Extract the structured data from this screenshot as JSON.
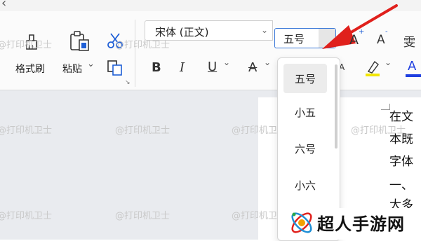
{
  "ribbon": {
    "format_painter_label": "格式刷",
    "paste_label": "粘贴",
    "paste_arrow": "⌄",
    "font_name": "宋体 (正文)",
    "font_size": "五号",
    "partial_right_label": "雯",
    "launcher": "↘"
  },
  "format": {
    "bold": "B",
    "italic": "I",
    "underline": "U",
    "strike": "A",
    "grow": "A",
    "shrink": "A",
    "chevron": "⌄"
  },
  "font_size_menu": [
    "五号",
    "小五",
    "六号",
    "小六"
  ],
  "document": {
    "lines": [
      "在文",
      "本既",
      "字体",
      "一、",
      "大多"
    ]
  },
  "watermark": "@打印机卫士",
  "logo_text": "超人手游网",
  "colors": {
    "accent_blue": "#3a78d8",
    "red_arrow": "#e0201c",
    "highlight_yellow": "#f2e600",
    "font_color_blue": "#1f3fe0"
  }
}
